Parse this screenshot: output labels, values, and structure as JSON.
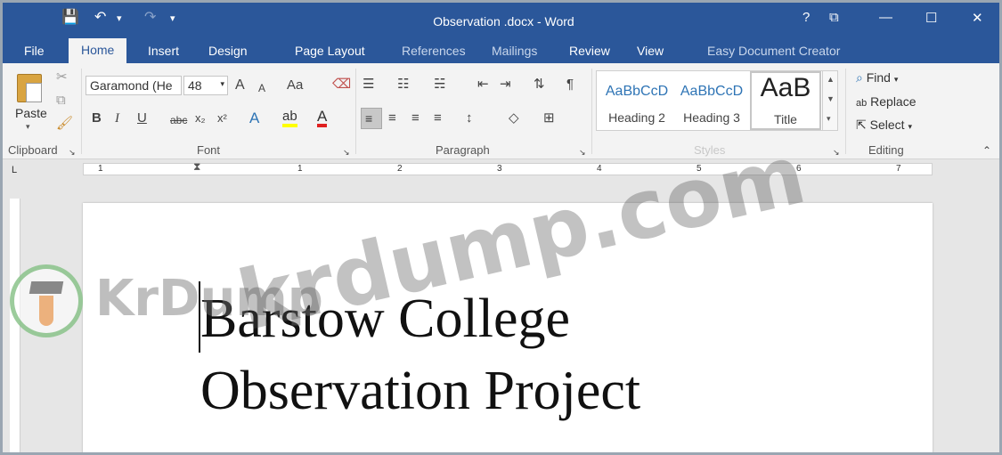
{
  "window": {
    "title": "Observation .docx  - Word",
    "help": "?",
    "ribbon_display": "⧉",
    "minimize": "—",
    "maximize": "☐",
    "close": "✕"
  },
  "qat": {
    "save": "💾",
    "undo": "↶",
    "undo_drop": "▾",
    "redo": "↷",
    "customize": "▾"
  },
  "tabs": [
    "File",
    "Home",
    "Insert",
    "Design",
    "Page Layout",
    "References",
    "Mailings",
    "Review",
    "View",
    "Easy Document Creator"
  ],
  "clipboard": {
    "paste_label": "Paste",
    "group_label": "Clipboard"
  },
  "font": {
    "name": "Garamond (He",
    "size": "48",
    "grow": "A",
    "shrink": "A",
    "case": "Aa",
    "bold": "B",
    "italic": "I",
    "underline": "U",
    "strike": "abc",
    "subscript": "x₂",
    "superscript": "x²",
    "group_label": "Font"
  },
  "paragraph": {
    "group_label": "Paragraph"
  },
  "styles": {
    "items": [
      {
        "preview": "AaBbCcD",
        "name": "Heading 2"
      },
      {
        "preview": "AaBbCcD",
        "name": "Heading 3"
      },
      {
        "preview": "AaB",
        "name": "Title"
      }
    ],
    "group_label": "Styles"
  },
  "editing": {
    "find": "Find",
    "replace": "Replace",
    "select": "Select",
    "group_label": "Editing"
  },
  "ruler": {
    "numbers": [
      "1",
      "1",
      "2",
      "3",
      "4",
      "5",
      "6",
      "7"
    ]
  },
  "document": {
    "line1": "Barstow College",
    "line2": "Observation Project"
  },
  "watermark": {
    "text": "krdump.com",
    "brand": "KrDump"
  },
  "colors": {
    "accent": "#2b579a",
    "ribbon": "#f3f3f3",
    "workspace": "#e6e6e6"
  }
}
